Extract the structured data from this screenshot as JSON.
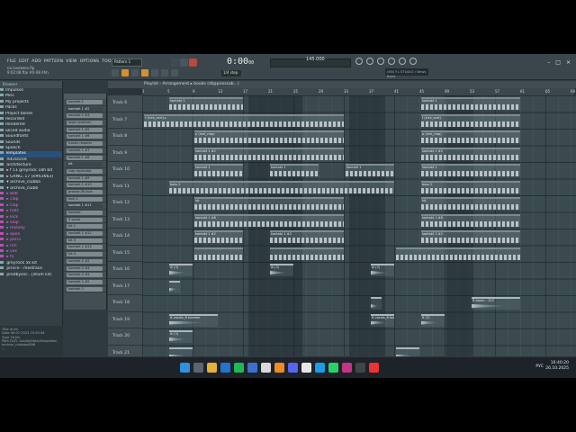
{
  "menu": [
    "FILE",
    "EDIT",
    "ADD",
    "PATTERN",
    "VIEW",
    "OPTIONS",
    "TOOLS",
    "HELP"
  ],
  "hint": {
    "line1": "na lovekoes.flp",
    "line2": "9:02:08 ftai #0-08 4hh"
  },
  "transport": {
    "time": "0:00",
    "time_small": "00",
    "tempo": "145.000",
    "pattern": "Pattern 1",
    "step": "1/4 step"
  },
  "newsbox": "(EN) FL STUDIO  / News Bank",
  "breadcrumb": "Playlist - Arrangement  ▸  boobs (dl@pirossab...)",
  "browser": {
    "header": "Browser",
    "items": [
      {
        "label": "Impulses",
        "pink": false
      },
      {
        "label": "Misc",
        "pink": false
      },
      {
        "label": "My projects",
        "pink": false
      },
      {
        "label": "Packs",
        "pink": false
      },
      {
        "label": "Project bones",
        "pink": false
      },
      {
        "label": "Recorded",
        "pink": false
      },
      {
        "label": "Rendered",
        "pink": false
      },
      {
        "label": "Sliced audio",
        "pink": false
      },
      {
        "label": "Soundfonts",
        "pink": false
      },
      {
        "label": "Sounds",
        "pink": false
      },
      {
        "label": "Speech",
        "pink": false
      },
      {
        "label": "Templates",
        "pink": false,
        "sel": true
      },
      {
        "label": "  Advanced",
        "pink": false
      },
      {
        "label": "  architecture",
        "pink": false
      },
      {
        "label": "   ▸ f 11 greyrock 18h bit",
        "pink": false
      },
      {
        "label": "   ▸ GRNG..17 (e#63663)",
        "pink": false
      },
      {
        "label": "   ▾ archive_clubba",
        "pink": false
      },
      {
        "label": "    ▾ archive_clubb",
        "pink": false
      },
      {
        "label": "      ▸ 808",
        "pink": true
      },
      {
        "label": "      ▸ clap",
        "pink": true
      },
      {
        "label": "      ▸ clap",
        "pink": true
      },
      {
        "label": "      ▸ hats",
        "pink": true
      },
      {
        "label": "      ▸ kick",
        "pink": true
      },
      {
        "label": "      ▸ loop",
        "pink": true
      },
      {
        "label": "      ▸ melody",
        "pink": true
      },
      {
        "label": "      ▸ open",
        "pink": true
      },
      {
        "label": "      ▸ percs",
        "pink": true
      },
      {
        "label": "      ▸ rim",
        "pink": true
      },
      {
        "label": "      ▸ vox",
        "pink": true
      },
      {
        "label": "      ▸ fx",
        "pink": true
      },
      {
        "label": "  greyrock 5k kit",
        "pink": false
      },
      {
        "label": "  prince - mestrace",
        "pink": false
      },
      {
        "label": "  prodbyxsc...(drum kit)",
        "pink": false
      }
    ],
    "footer": [
      "Title   drum",
      "Date   06.07.2023 19:20:44",
      "Type   16-bit",
      "Path   D:\\FL Studio\\Data\\Templates\\",
      "            archive_clubbaa\\808",
      "            ..."
    ]
  },
  "rack": [
    {
      "label": "kontakt 1",
      "dark": false
    },
    {
      "label": "kontakt 1 #2",
      "dark": true
    },
    {
      "label": "kontakt 1 #3",
      "dark": false
    },
    {
      "label": "layer reverser",
      "dark": false
    },
    {
      "label": "kontakt 1 #5",
      "dark": false
    },
    {
      "label": "kontakt 1 #6",
      "dark": false
    },
    {
      "label": "frozen respirer",
      "dark": false
    },
    {
      "label": "kontakt 1 #7",
      "dark": false
    },
    {
      "label": "kontakt 1 #8",
      "dark": false
    },
    {
      "label": "kit",
      "dark": true
    },
    {
      "label": "clap replicator",
      "dark": false
    },
    {
      "label": "kontakt 1 #9",
      "dark": false
    },
    {
      "label": "kontakt 1 #10",
      "dark": false
    },
    {
      "label": "groove (ft) box",
      "dark": false
    },
    {
      "label": "kick 2",
      "dark": false
    },
    {
      "label": "kontakt 1 #11",
      "dark": true
    },
    {
      "label": "kontakt",
      "dark": false
    },
    {
      "label": "3 vocal",
      "dark": false
    },
    {
      "label": "kit 2",
      "dark": false
    },
    {
      "label": "kontakt 1 #12",
      "dark": false
    },
    {
      "label": "kit 3",
      "dark": false
    },
    {
      "label": "kontakt 1 #13",
      "dark": false
    },
    {
      "label": "kit 4",
      "dark": false
    },
    {
      "label": "kontakt 2 #2",
      "dark": false
    },
    {
      "label": "kontakt 2 #3",
      "dark": false
    },
    {
      "label": "kontakt 2 #4",
      "dark": false
    },
    {
      "label": "kontakt 2 #5",
      "dark": false
    },
    {
      "label": "kontakt 2",
      "dark": false
    }
  ],
  "ruler": [
    "1",
    "5",
    "9",
    "13",
    "17",
    "21",
    "25",
    "29",
    "33",
    "37",
    "41",
    "45",
    "49",
    "53",
    "57",
    "61",
    "65",
    "69"
  ],
  "tracks": [
    "Track 6",
    "Track 7",
    "Track 8",
    "Track 9",
    "Track 10",
    "Track 11",
    "Track 12",
    "Track 13",
    "Track 14",
    "Track 15",
    "Track 16",
    "Track 17",
    "Track 18",
    "Track 19",
    "Track 20",
    "Track 21"
  ],
  "clips": [
    {
      "row": 0,
      "from": 1,
      "to": 4,
      "label": "kontakt 1",
      "kind": "notes"
    },
    {
      "row": 0,
      "from": 11,
      "to": 15,
      "label": "kontakt 1",
      "kind": "notes"
    },
    {
      "row": 1,
      "from": 0,
      "to": 8,
      "label": "f (kick_vert) ▸",
      "kind": "notes"
    },
    {
      "row": 1,
      "from": 11,
      "to": 15,
      "label": "f (kick_vert)",
      "kind": "notes"
    },
    {
      "row": 2,
      "from": 2,
      "to": 8,
      "label": "p (mel_clap)",
      "kind": "notes"
    },
    {
      "row": 2,
      "from": 11,
      "to": 15,
      "label": "p (mel_clap)",
      "kind": "notes"
    },
    {
      "row": 3,
      "from": 2,
      "to": 8,
      "label": "kontakt 1 #2",
      "kind": "notes"
    },
    {
      "row": 3,
      "from": 11,
      "to": 15,
      "label": "kontakt 1 #2",
      "kind": "notes"
    },
    {
      "row": 4,
      "from": 2,
      "to": 4,
      "label": "kontakt 1",
      "kind": "notes"
    },
    {
      "row": 4,
      "from": 5,
      "to": 7,
      "label": "kontakt 1",
      "kind": "notes"
    },
    {
      "row": 4,
      "from": 8,
      "to": 10,
      "label": "kontakt 1",
      "kind": "notes"
    },
    {
      "row": 4,
      "from": 11,
      "to": 15,
      "label": "kontakt 1",
      "kind": "notes"
    },
    {
      "row": 5,
      "from": 1,
      "to": 10,
      "label": "bass 2",
      "kind": "notes"
    },
    {
      "row": 5,
      "from": 11,
      "to": 15,
      "label": "bass 2",
      "kind": "notes"
    },
    {
      "row": 6,
      "from": 2,
      "to": 8,
      "label": "kit",
      "kind": "notes"
    },
    {
      "row": 6,
      "from": 11,
      "to": 15,
      "label": "kit",
      "kind": "notes"
    },
    {
      "row": 7,
      "from": 2,
      "to": 8,
      "label": "kontakt 1 #8",
      "kind": "notes"
    },
    {
      "row": 7,
      "from": 11,
      "to": 15,
      "label": "kontakt 1 #8",
      "kind": "notes"
    },
    {
      "row": 8,
      "from": 2,
      "to": 4,
      "label": "kontakt 1 #2",
      "kind": "notes"
    },
    {
      "row": 8,
      "from": 5,
      "to": 8,
      "label": "kontakt 1 #2",
      "kind": "notes"
    },
    {
      "row": 8,
      "from": 11,
      "to": 15,
      "label": "kontakt 1 #2",
      "kind": "notes"
    },
    {
      "row": 9,
      "from": 2,
      "to": 4,
      "label": "",
      "kind": "notes"
    },
    {
      "row": 9,
      "from": 5,
      "to": 8,
      "label": "",
      "kind": "notes"
    },
    {
      "row": 9,
      "from": 10,
      "to": 15,
      "label": "",
      "kind": "notes"
    },
    {
      "row": 10,
      "from": 1,
      "to": 2,
      "label": "lk (3)",
      "kind": "aud"
    },
    {
      "row": 10,
      "from": 5,
      "to": 6,
      "label": "lk (3)",
      "kind": "aud"
    },
    {
      "row": 10,
      "from": 9,
      "to": 10,
      "label": "lk (3)",
      "kind": "aud"
    },
    {
      "row": 11,
      "from": 1,
      "to": 1.5,
      "label": "",
      "kind": "aud"
    },
    {
      "row": 12,
      "from": 9,
      "to": 9.5,
      "label": "",
      "kind": "aud"
    },
    {
      "row": 12,
      "from": 13,
      "to": 15,
      "label": "ft boom - 123",
      "kind": "aud"
    },
    {
      "row": 13,
      "from": 1,
      "to": 3,
      "label": "ft vocals_ft boomer",
      "kind": "aud"
    },
    {
      "row": 13,
      "from": 9,
      "to": 10,
      "label": "ft vocals_ft boomer",
      "kind": "aud"
    },
    {
      "row": 13,
      "from": 11,
      "to": 12,
      "label": "ft (3)",
      "kind": "aud"
    },
    {
      "row": 14,
      "from": 1,
      "to": 2,
      "label": "lk (3)",
      "kind": "aud"
    },
    {
      "row": 15,
      "from": 1,
      "to": 2,
      "label": "",
      "kind": "aud"
    },
    {
      "row": 15,
      "from": 10,
      "to": 11,
      "label": "",
      "kind": "aud"
    }
  ],
  "taskbar": {
    "lang": "РУС",
    "time": "16:40:20",
    "date": "26.10.2025"
  },
  "colors": {
    "accent": "#d58f2f",
    "pink": "#e46bd6",
    "playlist_bg": "#3a4a4f"
  }
}
